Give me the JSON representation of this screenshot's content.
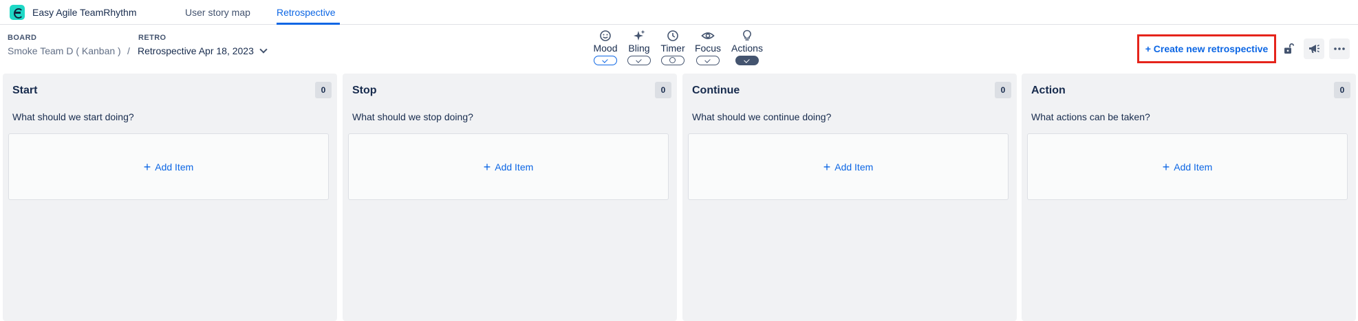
{
  "app": {
    "name": "Easy Agile TeamRhythm"
  },
  "nav": {
    "tabs": [
      {
        "label": "User story map"
      },
      {
        "label": "Retrospective",
        "active": true
      }
    ]
  },
  "breadcrumb": {
    "board_label": "BOARD",
    "board_value": "Smoke Team D ( Kanban )",
    "separator": "/",
    "retro_label": "RETRO",
    "retro_value": "Retrospective Apr 18, 2023"
  },
  "toolbar": {
    "tools": [
      {
        "label": "Mood",
        "icon": "smiley-icon",
        "state": "on-blue"
      },
      {
        "label": "Bling",
        "icon": "sparkles-icon",
        "state": "on"
      },
      {
        "label": "Timer",
        "icon": "clock-icon",
        "state": "clock"
      },
      {
        "label": "Focus",
        "icon": "eye-icon",
        "state": "on"
      },
      {
        "label": "Actions",
        "icon": "lightbulb-icon",
        "state": "on-dark"
      }
    ],
    "create_label": "+ Create new retrospective",
    "icons": [
      "unlock-icon",
      "megaphone-icon",
      "more-icon"
    ]
  },
  "columns": [
    {
      "title": "Start",
      "count": "0",
      "prompt": "What should we start doing?",
      "add_label": "Add Item"
    },
    {
      "title": "Stop",
      "count": "0",
      "prompt": "What should we stop doing?",
      "add_label": "Add Item"
    },
    {
      "title": "Continue",
      "count": "0",
      "prompt": "What should we continue doing?",
      "add_label": "Add Item"
    },
    {
      "title": "Action",
      "count": "0",
      "prompt": "What actions can be taken?",
      "add_label": "Add Item"
    }
  ],
  "colors": {
    "accent": "#0c66e4",
    "highlight": "#e5241b",
    "logo": "#1fd8c6"
  }
}
